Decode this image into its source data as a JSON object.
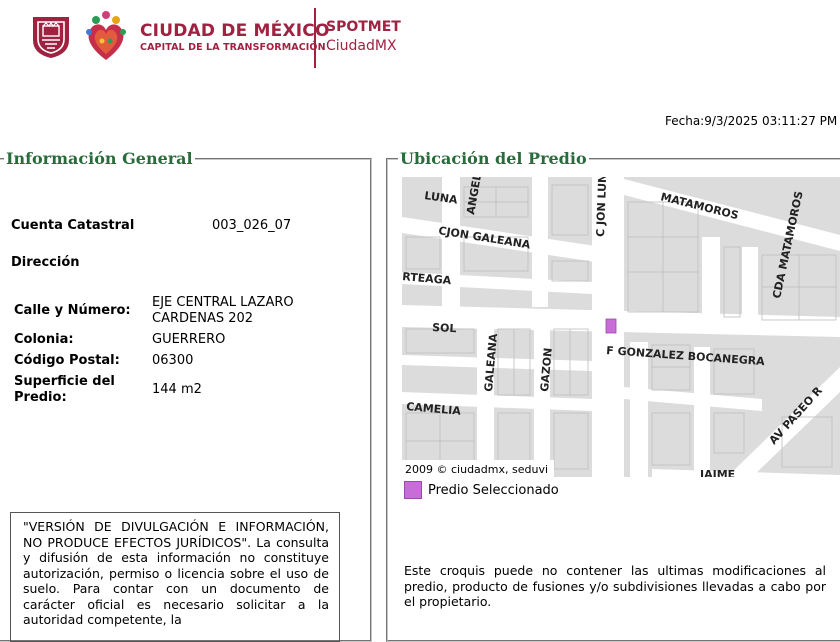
{
  "header": {
    "brand_main": "CIUDAD DE MÉXICO",
    "brand_sub": "CAPITAL DE LA TRANSFORMACIÓN",
    "app_name": "SPOTMET",
    "app_sub": "CiudadMX",
    "brand_color": "#9f2241"
  },
  "fecha": "Fecha:9/3/2025 03:11:27 PM",
  "info": {
    "title": "Información General",
    "cuenta_label": "Cuenta Catastral",
    "cuenta_value": "003_026_07",
    "direccion_label": "Dirección",
    "calle_label": "Calle y Número:",
    "calle_value_1": "EJE CENTRAL LAZARO",
    "calle_value_2": "CARDENAS 202",
    "colonia_label": "Colonia:",
    "colonia_value": "GUERRERO",
    "cp_label": "Código Postal:",
    "cp_value": "06300",
    "superficie_label_1": "Superficie del",
    "superficie_label_2": "Predio:",
    "superficie_value": "144 m2",
    "disclaimer": "\"VERSIÓN DE DIVULGACIÓN E INFORMACIÓN, NO PRODUCE EFECTOS JURÍDICOS\". La consulta y difusión de esta información no constituye autorización, permiso o licencia sobre el uso de suelo. Para contar con un documento de carácter oficial es necesario solicitar a la autoridad competente, la"
  },
  "ubicacion": {
    "title": "Ubicación del Predio",
    "map_labels": {
      "luna": "LUNA",
      "angel": "ANGEL",
      "jon_luna": "C JON LUNA",
      "matamoros": "MATAMOROS",
      "cjon_galeana": "CJON GALEANA",
      "cda_matamoros": "CDA MATAMOROS",
      "arteaga": "RTEAGA",
      "sol": "SOL",
      "galeana": "GALEANA",
      "gazon": "GAZON",
      "gonzalez": "F GONZALEZ BOCANEGRA",
      "camelia": "CAMELIA",
      "paseo": "AV PASEO R",
      "jaime": "JAIME",
      "copyright": "2009 © ciudadmx, seduvi"
    },
    "legend_label": "Predio Seleccionado",
    "legend_color": "#c86dd7",
    "note": "Este croquis puede no contener las ultimas modificaciones al predio, producto de fusiones y/o subdivisiones llevadas a cabo por el propietario."
  }
}
